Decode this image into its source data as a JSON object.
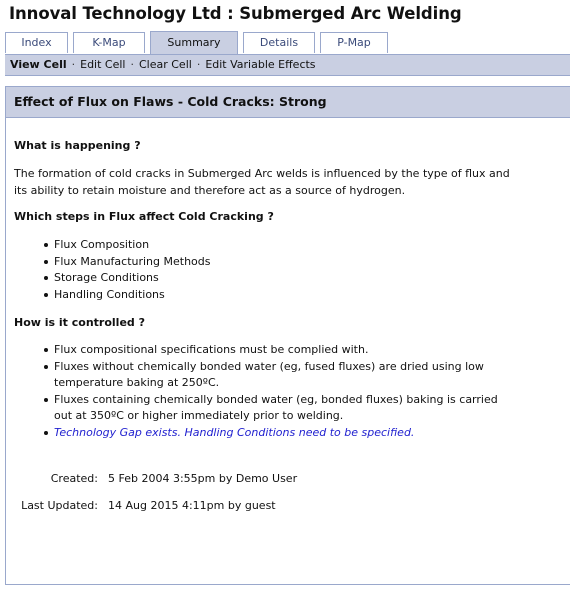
{
  "app": {
    "title": "Innoval Technology Ltd : Submerged Arc Welding"
  },
  "tabs": [
    {
      "label": "Index",
      "active": false
    },
    {
      "label": "K-Map",
      "active": false
    },
    {
      "label": "Summary",
      "active": true
    },
    {
      "label": "Details",
      "active": false
    },
    {
      "label": "P-Map",
      "active": false
    }
  ],
  "subnav": {
    "items": [
      {
        "label": "View Cell",
        "current": true
      },
      {
        "label": "Edit Cell",
        "current": false
      },
      {
        "label": "Clear Cell",
        "current": false
      },
      {
        "label": "Edit Variable Effects",
        "current": false
      }
    ],
    "separator": "·"
  },
  "panel": {
    "title": "Effect of Flux on Flaws - Cold Cracks: Strong",
    "sections": {
      "what": {
        "heading": "What is happening ?",
        "text": "The formation of cold cracks in Submerged Arc welds is influenced by the type of flux and its ability to retain moisture and therefore act as a source of hydrogen."
      },
      "steps": {
        "heading": "Which steps in Flux affect Cold Cracking ?",
        "items": [
          "Flux Composition",
          "Flux Manufacturing Methods",
          "Storage Conditions",
          "Handling Conditions"
        ]
      },
      "control": {
        "heading": "How is it controlled ?",
        "items": [
          "Flux compositional specifications must be complied with.",
          "Fluxes without chemically bonded water (eg, fused fluxes) are dried using low temperature baking at 250ºC.",
          "Fluxes containing chemically bonded water (eg, bonded fluxes) baking is carried out at 350ºC or higher immediately prior to welding."
        ],
        "gap_note": "Technology Gap exists. Handling Conditions need to be specified."
      }
    },
    "meta": {
      "created_label": "Created:",
      "created_value": "5 Feb 2004 3:55pm by Demo User",
      "updated_label": "Last Updated:",
      "updated_value": "14 Aug 2015 4:11pm by guest"
    }
  },
  "colors": {
    "band": "#c9cfe2",
    "border": "#9aa8cc",
    "gap_note": "#1e1ecf"
  }
}
